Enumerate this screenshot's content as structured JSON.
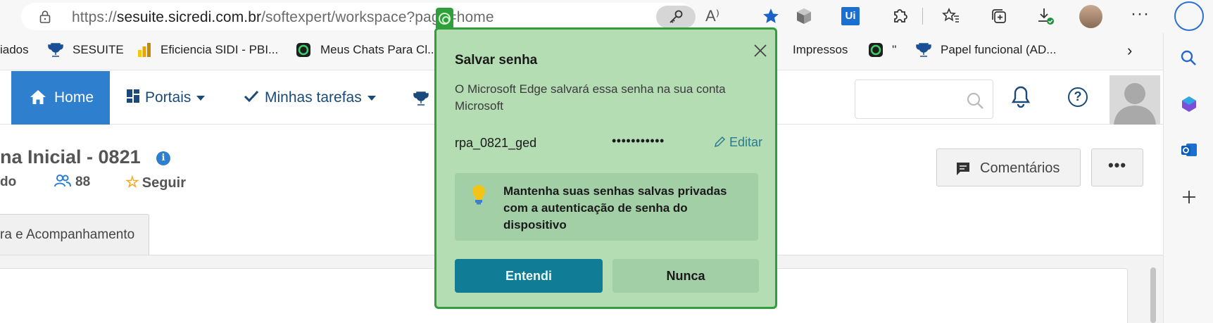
{
  "address_bar": {
    "url_host_prefix": "https://",
    "url_host": "sesuite.sicredi.com.br",
    "url_path": "/softexpert/workspace?page=home",
    "read_aloud_label": "A⁾"
  },
  "bookmarks": [
    {
      "label": "iados",
      "icon": "none"
    },
    {
      "label": "SESUITE",
      "icon": "trophy-icon"
    },
    {
      "label": "Eficiencia SIDI - PBI...",
      "icon": "powerbi-icon"
    },
    {
      "label": "Meus Chats Para Cl...",
      "icon": "chat-icon"
    },
    {
      "label": "Impressos",
      "icon": "none"
    },
    {
      "label": "''",
      "icon": "chat-icon"
    },
    {
      "label": "Papel funcional (AD...",
      "icon": "trophy-icon"
    }
  ],
  "nav": {
    "home": "Home",
    "portais": "Portais",
    "tarefas": "Minhas tarefas"
  },
  "page": {
    "title": "na Inicial - 0821",
    "meta_left": "do",
    "members_count": "88",
    "follow": "Seguir",
    "comments": "Comentários",
    "more": "•••",
    "tab_label": "ra e Acompanhamento"
  },
  "popup": {
    "title": "Salvar senha",
    "description": "O Microsoft Edge salvará essa senha na sua conta Microsoft",
    "username": "rpa_0821_ged",
    "password_mask": "•••••••••••",
    "edit": "Editar",
    "tip": "Mantenha suas senhas salvas privadas com a autenticação de senha do dispositivo",
    "ok_button": "Entendi",
    "never_button": "Nunca"
  },
  "colors": {
    "popup_bg": "#b5ddb4",
    "popup_border": "#2e9f3a",
    "primary": "#107c96",
    "nav_home_bg": "#2f7fcf",
    "nav_text": "#1b4a7a"
  }
}
